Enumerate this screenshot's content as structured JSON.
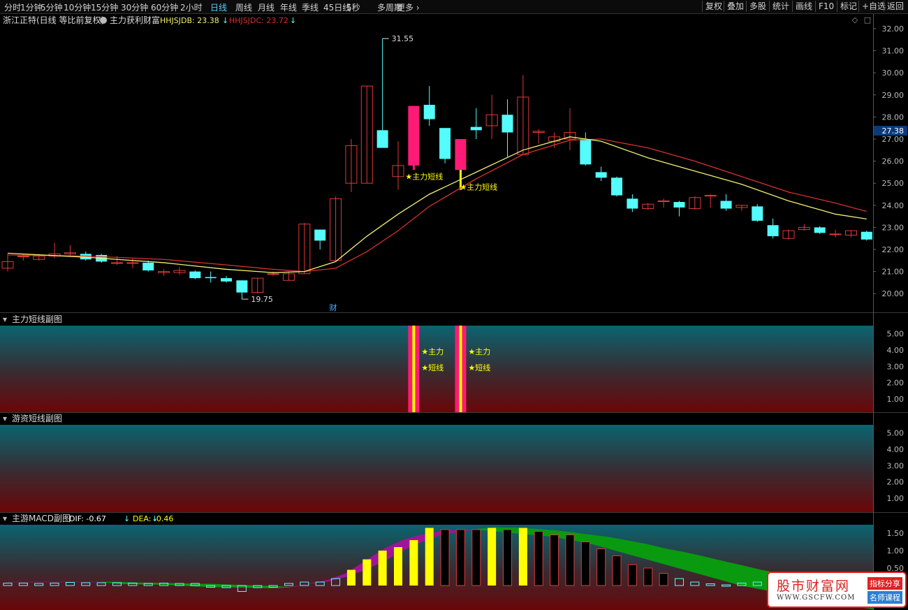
{
  "toolbar": {
    "periods": [
      "分时",
      "1分钟",
      "5分钟",
      "10分钟",
      "15分钟",
      "30分钟",
      "60分钟",
      "2小时",
      "日线",
      "周线",
      "月线",
      "年线",
      "季线",
      "45日线",
      "5秒",
      "多周期",
      "更多"
    ],
    "active_period": "日线",
    "right_buttons": [
      "复权",
      "叠加",
      "多股",
      "统计",
      "画线",
      "F10",
      "标记",
      "+自选",
      "返回"
    ]
  },
  "main_panel": {
    "title": "浙江正特(日线 等比前复权)",
    "indicator_name": "主力获利财富",
    "hhjsjdb_label": "HHJSJDB: 23.38",
    "hhjsjdc_label": "HHJSJDC: 23.72",
    "high_label": "31.55",
    "low_label": "19.75",
    "current_price": "27.38",
    "signal_label": "★主力短线",
    "cai_marker": "财",
    "y_ticks": [
      "32.00",
      "31.00",
      "30.00",
      "29.00",
      "28.00",
      "27.00",
      "26.00",
      "25.00",
      "24.00",
      "23.00",
      "22.00",
      "21.00",
      "20.00"
    ]
  },
  "panel2": {
    "title": "主力短线副图",
    "label_a": "★主力",
    "label_b": "★短线",
    "y_ticks": [
      "5.00",
      "4.00",
      "3.00",
      "2.00",
      "1.00"
    ]
  },
  "panel3": {
    "title": "游资短线副图",
    "y_ticks": [
      "5.00",
      "4.00",
      "3.00",
      "2.00",
      "1.00"
    ]
  },
  "panel4": {
    "title": "主游MACD副图",
    "dif_label": "DIF: -0.67",
    "dea_label": "DEA: -0.46",
    "y_ticks": [
      "1.50",
      "1.00",
      "0.50"
    ]
  },
  "watermark": {
    "name": "股市财富网",
    "url": "WWW.GSCFW.COM",
    "badge1": "指标分享",
    "badge2": "名师课程"
  },
  "colors": {
    "up": "#e0393a",
    "down": "#54fcfc",
    "signal_bar": "#ff1a75",
    "yellow": "#ffff00",
    "ma_short": "#f0f070",
    "ma_long": "#d83030",
    "macd_purple": "#a0149a",
    "macd_green": "#0a9a10",
    "accent": "#4fd0ff"
  },
  "chart_data": {
    "type": "candlestick",
    "candles": [
      {
        "o": 21.15,
        "h": 21.8,
        "l": 21.0,
        "c": 21.45
      },
      {
        "o": 21.7,
        "h": 21.8,
        "l": 21.5,
        "c": 21.7
      },
      {
        "o": 21.55,
        "h": 21.8,
        "l": 21.5,
        "c": 21.7
      },
      {
        "o": 21.7,
        "h": 22.3,
        "l": 21.6,
        "c": 21.8
      },
      {
        "o": 21.8,
        "h": 22.2,
        "l": 21.7,
        "c": 21.85
      },
      {
        "o": 21.8,
        "h": 21.9,
        "l": 21.5,
        "c": 21.55
      },
      {
        "o": 21.75,
        "h": 21.8,
        "l": 21.4,
        "c": 21.45
      },
      {
        "o": 21.4,
        "h": 21.7,
        "l": 21.3,
        "c": 21.4
      },
      {
        "o": 21.4,
        "h": 21.6,
        "l": 21.15,
        "c": 21.4
      },
      {
        "o": 21.4,
        "h": 21.5,
        "l": 21.0,
        "c": 21.05
      },
      {
        "o": 20.95,
        "h": 21.1,
        "l": 20.8,
        "c": 21.0
      },
      {
        "o": 20.95,
        "h": 21.2,
        "l": 20.85,
        "c": 21.05
      },
      {
        "o": 21.0,
        "h": 21.05,
        "l": 20.65,
        "c": 20.7
      },
      {
        "o": 20.75,
        "h": 21.0,
        "l": 20.5,
        "c": 20.7
      },
      {
        "o": 20.7,
        "h": 20.8,
        "l": 20.5,
        "c": 20.55
      },
      {
        "o": 20.6,
        "h": 20.6,
        "l": 19.75,
        "c": 20.05
      },
      {
        "o": 20.05,
        "h": 20.7,
        "l": 20.0,
        "c": 20.7
      },
      {
        "o": 20.9,
        "h": 21.0,
        "l": 20.8,
        "c": 20.9
      },
      {
        "o": 20.6,
        "h": 21.0,
        "l": 20.6,
        "c": 20.9
      },
      {
        "o": 20.9,
        "h": 23.2,
        "l": 20.9,
        "c": 23.15
      },
      {
        "o": 22.9,
        "h": 22.9,
        "l": 22.0,
        "c": 22.4
      },
      {
        "o": 21.5,
        "h": 24.4,
        "l": 21.5,
        "c": 24.3
      },
      {
        "o": 25.0,
        "h": 27.0,
        "l": 24.6,
        "c": 26.7
      },
      {
        "o": 25.0,
        "h": 29.4,
        "l": 25.0,
        "c": 29.4
      },
      {
        "o": 27.4,
        "h": 31.55,
        "l": 26.7,
        "c": 26.6
      },
      {
        "o": 25.3,
        "h": 26.9,
        "l": 24.7,
        "c": 25.8
      },
      {
        "o": 25.8,
        "h": 28.5,
        "l": 25.6,
        "c": 28.5
      },
      {
        "o": 28.55,
        "h": 29.4,
        "l": 27.6,
        "c": 27.9
      },
      {
        "o": 27.5,
        "h": 27.5,
        "l": 25.9,
        "c": 26.1
      },
      {
        "o": 25.6,
        "h": 27.0,
        "l": 24.7,
        "c": 27.0
      },
      {
        "o": 27.55,
        "h": 28.4,
        "l": 27.0,
        "c": 27.4
      },
      {
        "o": 27.6,
        "h": 29.0,
        "l": 27.0,
        "c": 28.1
      },
      {
        "o": 28.1,
        "h": 28.8,
        "l": 26.2,
        "c": 27.3
      },
      {
        "o": 26.3,
        "h": 29.9,
        "l": 26.3,
        "c": 28.9
      },
      {
        "o": 27.3,
        "h": 27.45,
        "l": 26.8,
        "c": 27.35
      },
      {
        "o": 26.9,
        "h": 27.3,
        "l": 26.6,
        "c": 27.1
      },
      {
        "o": 27.0,
        "h": 28.4,
        "l": 26.5,
        "c": 27.3
      },
      {
        "o": 27.0,
        "h": 27.3,
        "l": 25.8,
        "c": 25.85
      },
      {
        "o": 25.5,
        "h": 25.75,
        "l": 25.1,
        "c": 25.25
      },
      {
        "o": 25.25,
        "h": 25.3,
        "l": 24.4,
        "c": 24.45
      },
      {
        "o": 24.3,
        "h": 24.5,
        "l": 23.7,
        "c": 23.85
      },
      {
        "o": 23.85,
        "h": 24.1,
        "l": 23.8,
        "c": 24.05
      },
      {
        "o": 24.2,
        "h": 24.3,
        "l": 23.9,
        "c": 24.2
      },
      {
        "o": 24.15,
        "h": 24.2,
        "l": 23.5,
        "c": 23.9
      },
      {
        "o": 23.85,
        "h": 24.4,
        "l": 23.8,
        "c": 24.35
      },
      {
        "o": 24.45,
        "h": 24.5,
        "l": 23.9,
        "c": 24.45
      },
      {
        "o": 24.2,
        "h": 24.5,
        "l": 23.75,
        "c": 23.85
      },
      {
        "o": 23.9,
        "h": 24.0,
        "l": 23.75,
        "c": 24.0
      },
      {
        "o": 23.95,
        "h": 24.05,
        "l": 23.25,
        "c": 23.3
      },
      {
        "o": 23.1,
        "h": 23.4,
        "l": 22.5,
        "c": 22.6
      },
      {
        "o": 22.5,
        "h": 22.9,
        "l": 22.45,
        "c": 22.85
      },
      {
        "o": 22.9,
        "h": 23.15,
        "l": 22.85,
        "c": 23.0
      },
      {
        "o": 23.0,
        "h": 23.05,
        "l": 22.7,
        "c": 22.75
      },
      {
        "o": 22.7,
        "h": 22.9,
        "l": 22.55,
        "c": 22.7
      },
      {
        "o": 22.65,
        "h": 22.85,
        "l": 22.55,
        "c": 22.85
      },
      {
        "o": 22.8,
        "h": 22.85,
        "l": 22.4,
        "c": 22.45
      }
    ],
    "ma_short": [
      [
        0,
        21.83
      ],
      [
        5,
        21.65
      ],
      [
        10,
        21.4
      ],
      [
        14,
        21.1
      ],
      [
        17,
        20.95
      ],
      [
        19,
        21.0
      ],
      [
        21,
        21.45
      ],
      [
        23,
        22.6
      ],
      [
        25,
        23.6
      ],
      [
        27,
        24.5
      ],
      [
        30,
        25.5
      ],
      [
        33,
        26.5
      ],
      [
        36,
        27.1
      ],
      [
        38,
        26.9
      ],
      [
        41,
        26.15
      ],
      [
        44,
        25.55
      ],
      [
        47,
        24.95
      ],
      [
        50,
        24.2
      ],
      [
        53,
        23.6
      ],
      [
        55,
        23.38
      ]
    ],
    "ma_long": [
      [
        0,
        21.75
      ],
      [
        5,
        21.7
      ],
      [
        10,
        21.55
      ],
      [
        14,
        21.3
      ],
      [
        17,
        21.1
      ],
      [
        19,
        21.0
      ],
      [
        21,
        21.15
      ],
      [
        23,
        21.9
      ],
      [
        25,
        22.85
      ],
      [
        27,
        23.95
      ],
      [
        30,
        25.2
      ],
      [
        33,
        26.3
      ],
      [
        36,
        26.95
      ],
      [
        38,
        27.0
      ],
      [
        41,
        26.6
      ],
      [
        44,
        26.0
      ],
      [
        47,
        25.3
      ],
      [
        50,
        24.6
      ],
      [
        53,
        24.1
      ],
      [
        55,
        23.72
      ]
    ],
    "signals": [
      26,
      29
    ],
    "macd": [
      0.07,
      0.07,
      0.06,
      0.07,
      0.09,
      0.08,
      0.08,
      0.08,
      0.07,
      0.06,
      0.07,
      0.06,
      0.06,
      -0.05,
      -0.06,
      -0.17,
      -0.06,
      -0.05,
      0.06,
      0.1,
      0.1,
      0.2,
      0.45,
      0.75,
      1.0,
      1.1,
      1.3,
      1.65,
      1.6,
      1.6,
      1.6,
      1.65,
      1.6,
      1.65,
      1.55,
      1.45,
      1.45,
      1.25,
      1.05,
      0.85,
      0.6,
      0.5,
      0.35,
      0.2,
      0.1,
      0.05,
      0.02,
      0.07,
      0.1,
      0.1,
      0.05,
      -0.05,
      -0.15,
      -0.25,
      -0.3,
      -0.3
    ],
    "macd_yellow": [
      22,
      23,
      24,
      25,
      26,
      27,
      31,
      33
    ],
    "dif": [
      0.1,
      0.1,
      0.1,
      0.1,
      0.1,
      0.1,
      0.05,
      0.04,
      0.03,
      0.01,
      -0.02,
      -0.04,
      -0.05,
      -0.06,
      -0.07,
      -0.05,
      0.05,
      0.15,
      0.35,
      0.7,
      1.05,
      1.3,
      1.45,
      1.55,
      1.6,
      1.6,
      1.55,
      1.5,
      1.45,
      1.4,
      1.3,
      1.2,
      1.05,
      0.9,
      0.75,
      0.6,
      0.45,
      0.3,
      0.15,
      0.0,
      -0.1,
      -0.2,
      -0.3,
      -0.4,
      -0.5,
      -0.6,
      -0.67
    ],
    "dea": [
      0.1,
      0.1,
      0.1,
      0.1,
      0.1,
      0.1,
      0.1,
      0.08,
      0.07,
      0.06,
      0.05,
      0.04,
      0.02,
      0.0,
      -0.02,
      -0.05,
      0.05,
      0.12,
      0.25,
      0.45,
      0.7,
      1.0,
      1.25,
      1.45,
      1.55,
      1.62,
      1.66,
      1.65,
      1.62,
      1.58,
      1.52,
      1.45,
      1.38,
      1.28,
      1.18,
      1.05,
      0.95,
      0.83,
      0.7,
      0.58,
      0.45,
      0.35,
      0.25,
      0.15,
      0.05,
      -0.05,
      -0.46
    ]
  }
}
